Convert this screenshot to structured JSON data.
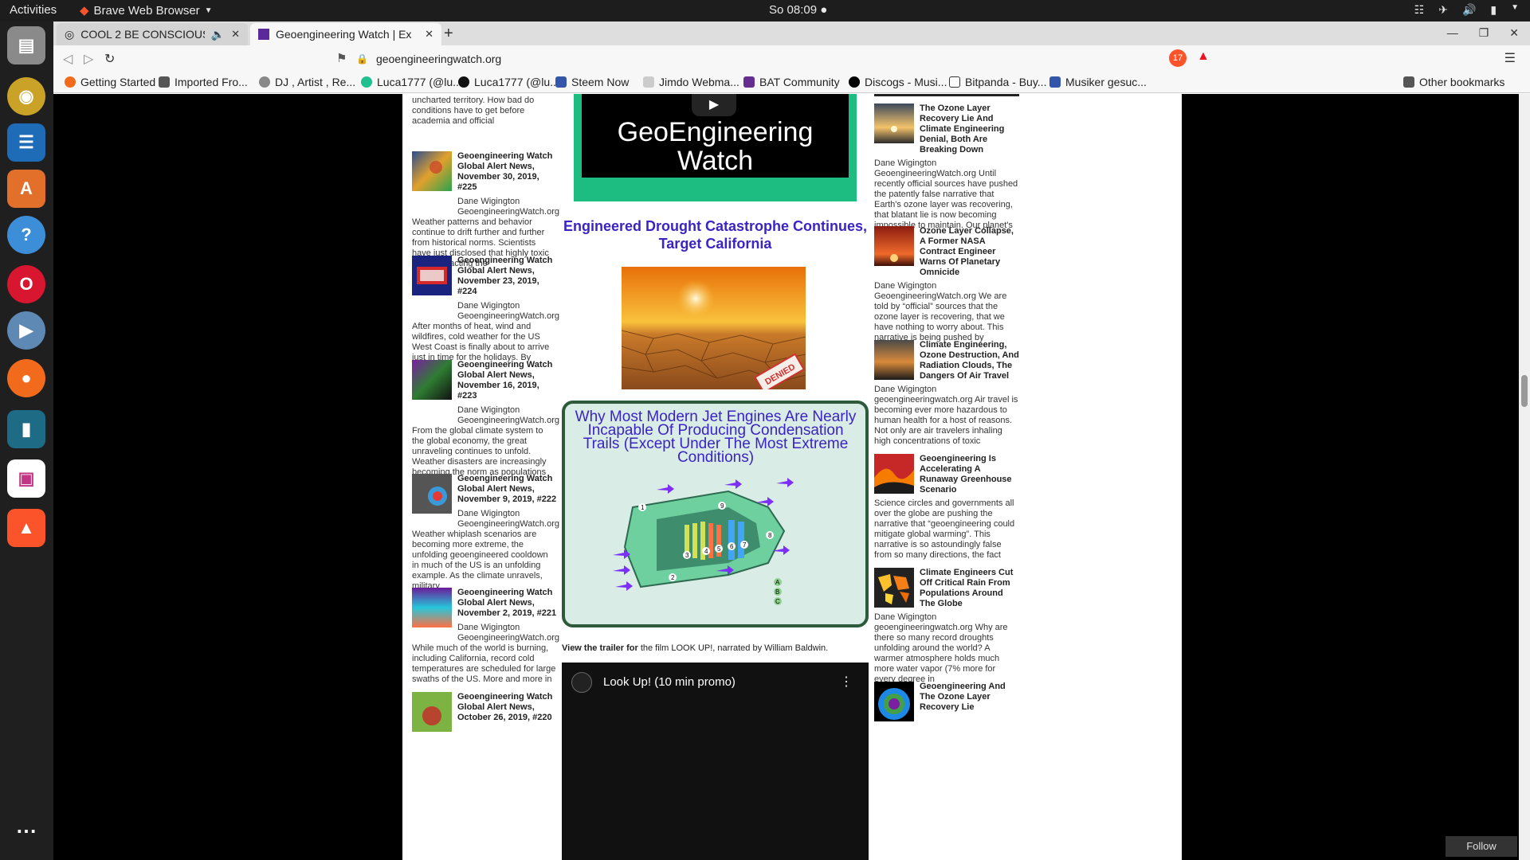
{
  "system": {
    "activities": "Activities",
    "app_name": "Brave Web Browser",
    "clock": "So 08:09"
  },
  "tabs": [
    {
      "title": "COOL 2 BE CONSCIOUS"
    },
    {
      "title": "Geoengineering Watch | Ex"
    }
  ],
  "url": "geoengineeringwatch.org",
  "shield_count": "17",
  "bookmarks": [
    "Getting Started",
    "Imported Fro...",
    "DJ , Artist , Re...",
    "Luca1777 (@lu...",
    "Luca1777 (@lu...",
    "Steem Now",
    "Jimdo Webma...",
    "BAT Community",
    "Discogs - Musi...",
    "Bitpanda - Buy...",
    "Musiker gesuc...",
    "Other bookmarks"
  ],
  "left_snippet": "uncharted territory. How bad do conditions have to get before academia and official",
  "left_posts": [
    {
      "title": "Geoengineering Watch Global Alert News, November 30, 2019, #225",
      "author": "Dane Wigington GeoengineeringWatch.org",
      "text": "Weather patterns and behavior continue to drift further and further from historical norms. Scientists have just disclosed that highly toxic fog is impacting the"
    },
    {
      "title": "Geoengineering Watch Global Alert News, November 23, 2019, #224",
      "author": "Dane Wigington GeoengineeringWatch.org",
      "text": "After months of heat, wind and wildfires, cold weather for the US West Coast is finally about to arrive just in time for the holidays. By contrast,"
    },
    {
      "title": "Geoengineering Watch Global Alert News, November 16, 2019, #223",
      "author": "Dane Wigington GeoengineeringWatch.org",
      "text": "From the global climate system to the global economy, the great unraveling continues to unfold. Weather disasters are increasingly becoming the norm as populations"
    },
    {
      "title": "Geoengineering Watch Global Alert News, November 9, 2019, #222",
      "author": "Dane Wigington GeoengineeringWatch.org",
      "text": "Weather whiplash scenarios are becoming more extreme, the unfolding geoengineered cooldown in much of the US is an unfolding example. As the climate unravels, military"
    },
    {
      "title": "Geoengineering Watch Global Alert News, November 2, 2019, #221",
      "author": "Dane Wigington GeoengineeringWatch.org",
      "text": "While much of the world is burning, including California, record cold temperatures are scheduled for large swaths of the US. More and more in"
    },
    {
      "title": "Geoengineering Watch Global Alert News, October 26, 2019, #220",
      "author": "",
      "text": ""
    }
  ],
  "center": {
    "video_brand_line1": "GeoEngineering",
    "video_brand_line2": "Watch",
    "drought_link": "Engineered Drought Catastrophe Continues, Target California",
    "denied_stamp": "DENIED",
    "jet_title": "Why Most Modern Jet Engines Are Nearly Incapable Of Producing Condensation Trails (Except Under The Most Extreme Conditions)",
    "trailer_bold": "View the trailer for",
    "trailer_rest": " the film LOOK UP!, narrated by William Baldwin.",
    "video2_title": "Look Up! (10 min promo)"
  },
  "right_posts": [
    {
      "title": "The Ozone Layer Recovery Lie And Climate Engineering Denial, Both Are Breaking Down",
      "text": "Dane Wigington GeoengineeringWatch.org Until recently official sources have pushed the patently false narrative that Earth's ozone layer was recovering, that blatant lie is now becoming impossible to maintain. Our planet's"
    },
    {
      "title": "Ozone Layer Collapse, A Former NASA Contract Engineer Warns Of Planetary Omnicide",
      "text": "Dane Wigington GeoengineeringWatch.org We are told by “official” sources that the ozone layer is recovering, that we have nothing to worry about. This narrative is being pushed by"
    },
    {
      "title": "Climate Engineering, Ozone Destruction, And Radiation Clouds, The Dangers Of Air Travel",
      "text": "Dane Wigington geoengineeringwatch.org Air travel is becoming ever more hazardous to human health for a host of reasons. Not only are air travelers inhaling high concentrations of toxic"
    },
    {
      "title": "Geoengineering Is Accelerating A Runaway Greenhouse Scenario",
      "text": "Science circles and governments all over the globe are pushing the narrative that “geoengineering could mitigate global warming”. This narrative is so astoundingly false from so many directions, the fact"
    },
    {
      "title": "Climate Engineers Cut Off Critical Rain From Populations Around The Globe",
      "text": "Dane Wigington geoengineeringwatch.org Why are there so many record droughts unfolding around the world? A warmer atmosphere holds much more water vapor (7% more for every degree in"
    },
    {
      "title": "Geoengineering And The Ozone Layer Recovery Lie",
      "text": ""
    }
  ],
  "follow_label": "Follow"
}
